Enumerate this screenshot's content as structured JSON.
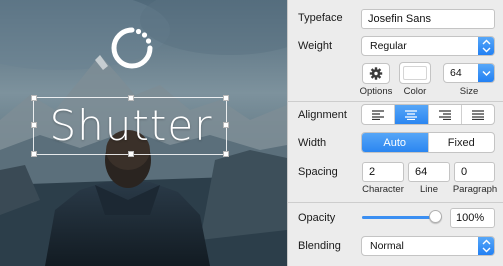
{
  "canvas": {
    "headline": "Shutter"
  },
  "inspector": {
    "typeface": {
      "label": "Typeface",
      "value": "Josefin Sans"
    },
    "weight": {
      "label": "Weight",
      "value": "Regular"
    },
    "options": {
      "label": "Options"
    },
    "color": {
      "label": "Color",
      "value": "#ffffff"
    },
    "size": {
      "label": "Size",
      "value": "64"
    },
    "alignment": {
      "label": "Alignment",
      "selected": "center",
      "options": [
        "left",
        "center",
        "right",
        "justify"
      ]
    },
    "width": {
      "label": "Width",
      "options": [
        "Auto",
        "Fixed"
      ],
      "selected": "Auto"
    },
    "spacing": {
      "label": "Spacing",
      "character": {
        "label": "Character",
        "value": "2"
      },
      "line": {
        "label": "Line",
        "value": "64"
      },
      "paragraph": {
        "label": "Paragraph",
        "value": "0"
      }
    },
    "opacity": {
      "label": "Opacity",
      "value": "100%",
      "level": 1.0
    },
    "blending": {
      "label": "Blending",
      "value": "Normal"
    }
  },
  "colors": {
    "accent": "#2b86f1",
    "panel_bg": "#ececec"
  }
}
